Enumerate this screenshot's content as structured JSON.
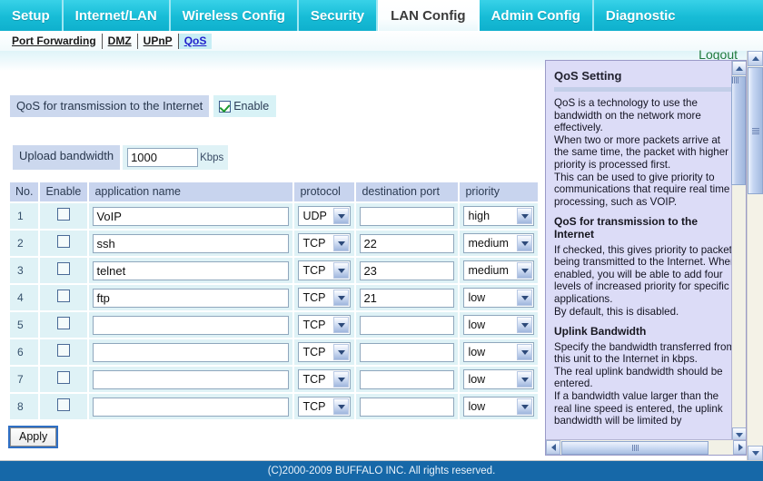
{
  "nav": {
    "tabs": [
      {
        "label": "Setup",
        "active": false
      },
      {
        "label": "Internet/LAN",
        "active": false
      },
      {
        "label": "Wireless Config",
        "active": false
      },
      {
        "label": "Security",
        "active": false
      },
      {
        "label": "LAN Config",
        "active": true
      },
      {
        "label": "Admin Config",
        "active": false
      },
      {
        "label": "Diagnostic",
        "active": false
      }
    ]
  },
  "subnav": {
    "tabs": [
      {
        "label": "Port Forwarding",
        "active": false
      },
      {
        "label": "DMZ",
        "active": false
      },
      {
        "label": "UPnP",
        "active": false
      },
      {
        "label": "QoS",
        "active": true
      }
    ]
  },
  "logout": {
    "label": "Logout"
  },
  "form": {
    "qos_label": "QoS for transmission to the Internet",
    "enable_label": "Enable",
    "enable_checked": true,
    "bandwidth_label": "Upload bandwidth",
    "bandwidth_value": "1000",
    "bandwidth_unit": "Kbps",
    "apply_label": "Apply"
  },
  "table": {
    "headers": [
      "No.",
      "Enable",
      "application name",
      "protocol",
      "destination port",
      "priority"
    ],
    "rows": [
      {
        "no": "1",
        "enabled": false,
        "app": "VoIP",
        "protocol": "UDP",
        "port": "",
        "priority": "high"
      },
      {
        "no": "2",
        "enabled": false,
        "app": "ssh",
        "protocol": "TCP",
        "port": "22",
        "priority": "medium"
      },
      {
        "no": "3",
        "enabled": false,
        "app": "telnet",
        "protocol": "TCP",
        "port": "23",
        "priority": "medium"
      },
      {
        "no": "4",
        "enabled": false,
        "app": "ftp",
        "protocol": "TCP",
        "port": "21",
        "priority": "low"
      },
      {
        "no": "5",
        "enabled": false,
        "app": "",
        "protocol": "TCP",
        "port": "",
        "priority": "low"
      },
      {
        "no": "6",
        "enabled": false,
        "app": "",
        "protocol": "TCP",
        "port": "",
        "priority": "low"
      },
      {
        "no": "7",
        "enabled": false,
        "app": "",
        "protocol": "TCP",
        "port": "",
        "priority": "low"
      },
      {
        "no": "8",
        "enabled": false,
        "app": "",
        "protocol": "TCP",
        "port": "",
        "priority": "low"
      }
    ],
    "protocol_options": [
      "TCP",
      "UDP"
    ],
    "priority_options": [
      "high",
      "medium",
      "low"
    ]
  },
  "help": {
    "title": "QoS Setting",
    "intro": "QoS is a technology to use the bandwidth on the network more effectively.\nWhen two or more packets arrive at the same time, the packet with higher priority is processed first.\nThis can be used to give priority to communications that require real time processing, such as VOIP.",
    "section2_title": "QoS for transmission to the Internet",
    "section2_body": "If checked, this gives priority to packets being transmitted to the Internet. When enabled, you will be able to add four levels of increased priority for specific applications.\nBy default, this is disabled.",
    "section3_title": "Uplink Bandwidth",
    "section3_body": "Specify the bandwidth transferred from this unit to the Internet in kbps.\nThe real uplink bandwidth should be entered.\nIf a bandwidth value larger than the real line speed is entered, the uplink bandwidth will be limited by"
  },
  "footer": {
    "text": "(C)2000-2009 BUFFALO INC. All rights reserved."
  },
  "icons": {
    "scroll_up": "chevron-up-icon",
    "scroll_down": "chevron-down-icon",
    "scroll_left": "chevron-left-icon",
    "scroll_right": "chevron-right-icon"
  }
}
